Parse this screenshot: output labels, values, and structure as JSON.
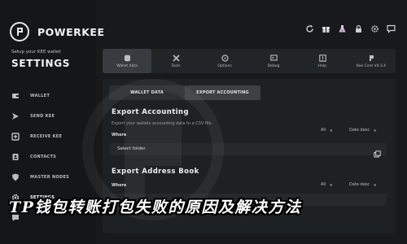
{
  "brand": {
    "name": "POWERKEE"
  },
  "sidebar": {
    "setup_text": "Setup your KEE wallet",
    "title": "SETTINGS",
    "items": [
      {
        "label": "WALLET",
        "icon": "wallet-icon"
      },
      {
        "label": "SEND KEE",
        "icon": "send-icon"
      },
      {
        "label": "RECEIVE KEE",
        "icon": "receive-icon"
      },
      {
        "label": "CONTACTS",
        "icon": "contacts-icon"
      },
      {
        "label": "MASTER NODES",
        "icon": "shield-icon"
      },
      {
        "label": "SETTINGS",
        "icon": "gear-icon"
      },
      {
        "label": "",
        "icon": "chat-icon"
      }
    ]
  },
  "toolbar": {
    "icons": [
      "refresh-icon",
      "gift-icon",
      "flask-icon",
      "lock-icon",
      "settings-icon",
      "chat-icon"
    ]
  },
  "tabs": [
    {
      "label": "Wallet data",
      "icon": "database-icon"
    },
    {
      "label": "Tools",
      "icon": "tools-icon"
    },
    {
      "label": "Options",
      "icon": "options-icon"
    },
    {
      "label": "Debug",
      "icon": "debug-icon"
    },
    {
      "label": "Help",
      "icon": "help-icon"
    },
    {
      "label": "Kee Core V4.3.4",
      "icon": "kee-icon"
    }
  ],
  "subtabs": {
    "wallet_data": "WALLET DATA",
    "export_accounting": "EXPORT ACCOUNTING"
  },
  "export_accounting": {
    "title": "Export Accounting",
    "description": "Export your wallets accounting data to a CSV file.",
    "where": "Where",
    "filter_value": "All",
    "sort_value": "Date desc",
    "folder_placeholder": "Select folder"
  },
  "export_address_book": {
    "title": "Export Address Book",
    "where": "Where",
    "filter_value": "All",
    "sort_value": "Date desc"
  },
  "overlay_text": "TP钱包转账打包失败的原因及解决方法",
  "colors": {
    "background": "#17191b",
    "panel": "#1e2123",
    "active_tab": "#383c40"
  }
}
